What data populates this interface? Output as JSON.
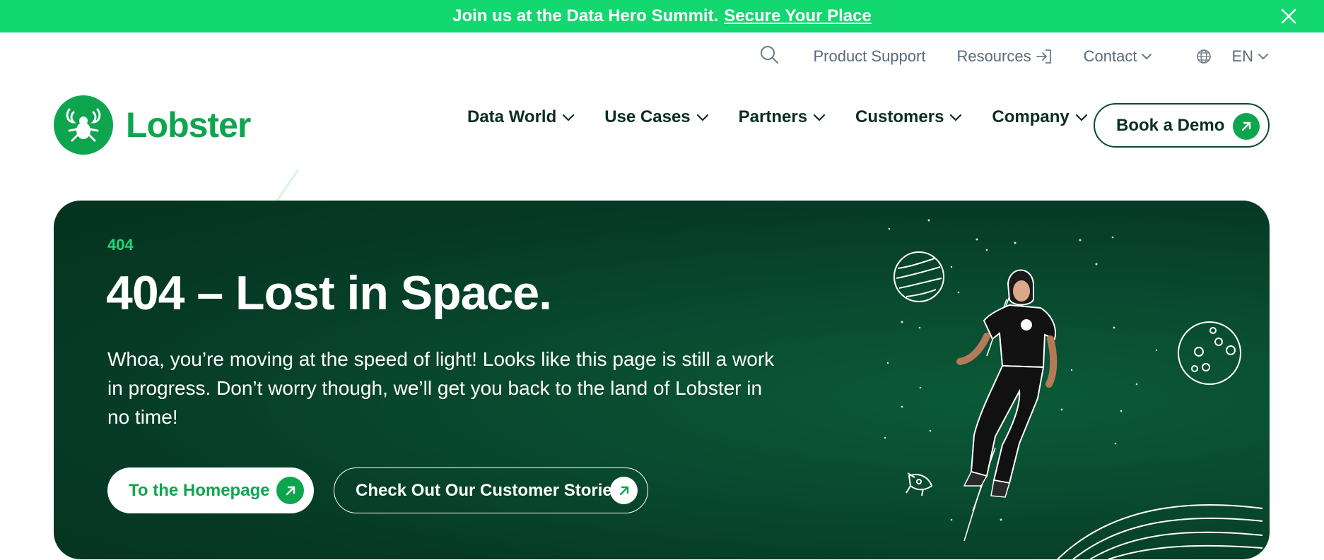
{
  "announcement": {
    "message": "Join us at the Data Hero Summit.",
    "link": "Secure Your Place",
    "close_icon": "close-icon"
  },
  "utility_nav": {
    "search_icon": "search-icon",
    "items": [
      {
        "label": "Product Support"
      },
      {
        "label": "Resources"
      },
      {
        "label": "Contact"
      }
    ],
    "language": "EN",
    "globe_icon": "globe-icon"
  },
  "logo": {
    "name": "Lobster",
    "icon": "lobster-logo-icon"
  },
  "main_nav": {
    "items": [
      {
        "label": "Data World"
      },
      {
        "label": "Use Cases"
      },
      {
        "label": "Partners"
      },
      {
        "label": "Customers"
      },
      {
        "label": "Company"
      }
    ],
    "cta": "Book a Demo"
  },
  "hero": {
    "eyebrow": "404",
    "title": "404 – Lost in Space.",
    "body": "Whoa, you’re moving at the speed of light! Looks like this page is still a work in progress. Don’t worry though, we’ll get you back to the land of Lobster in no time!",
    "primary_button": "To the Homepage",
    "secondary_button": "Check Out Our Customer Stories"
  },
  "colors": {
    "brand_green": "#0fa54f",
    "announce_green": "#12d86f",
    "hero_dark": "#063a26",
    "accent_text": "#1bd877"
  }
}
